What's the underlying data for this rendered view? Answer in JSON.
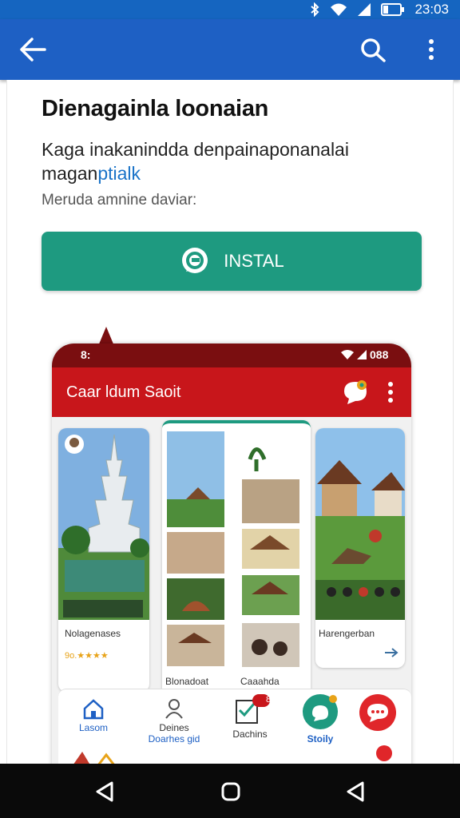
{
  "status_bar": {
    "time": "23:03"
  },
  "app_bar": {
    "back_icon": "arrow-back-icon",
    "search_icon": "search-icon",
    "more_icon": "more-vert-icon"
  },
  "listing": {
    "title": "Dienagainla loonaian",
    "description_line1": "Kaga inakanindda denpainaponanalai",
    "description_line2_plain": "magan",
    "description_line2_link": "ptialk",
    "subtitle": "Meruda amnine daviar:",
    "install_label": "INSTAL",
    "accent": "#1e9a80"
  },
  "phone": {
    "status_time": "8:",
    "status_right": "088",
    "app_title": "Caar ldum Saoit",
    "col1": {
      "label": "Nolagenases",
      "rating_text": "9o.★★★★"
    },
    "col2": {
      "label_left": "Blonadoat",
      "label_right": "Caaahda"
    },
    "col3": {
      "label": "Harengerban"
    },
    "nav": [
      {
        "label": "Lasom",
        "icon": "home-icon"
      },
      {
        "label": "Deines",
        "label2": "Doarhes gid",
        "icon": "person-icon"
      },
      {
        "label": "Dachins",
        "icon": "checklist-icon",
        "badge": "8"
      },
      {
        "label": "Stoily",
        "icon": "chat-icon"
      },
      {
        "label": "",
        "icon": "message-icon"
      }
    ],
    "brand_color": "#c8161b"
  },
  "system_nav": {
    "back": "back-triangle-icon",
    "home": "home-circle-icon",
    "recent": "back-triangle-icon"
  }
}
